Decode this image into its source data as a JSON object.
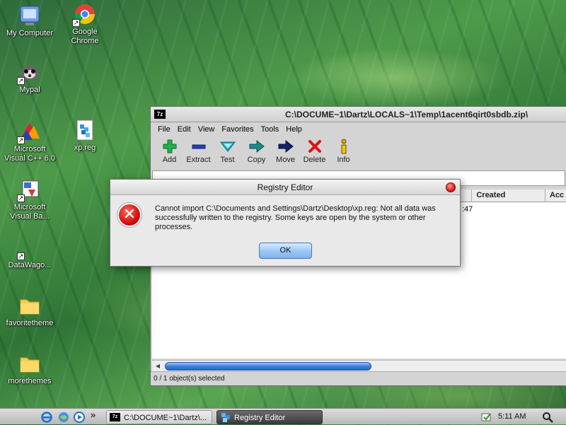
{
  "desktop": {
    "icons": [
      {
        "label": "My Computer",
        "icon": "computer-icon"
      },
      {
        "label": "Google\nChrome",
        "icon": "chrome-icon"
      },
      {
        "label": "Mypal",
        "icon": "mypal-icon"
      },
      {
        "label": "Microsoft\nVisual C++ 6.0",
        "icon": "visual-cpp-icon"
      },
      {
        "label": "xp.reg",
        "icon": "reg-file-icon"
      },
      {
        "label": "Microsoft\nVisual Ba...",
        "icon": "visual-basic-icon"
      },
      {
        "label": "DataWago...",
        "icon": "datawagon-icon"
      },
      {
        "label": "favoritetheme",
        "icon": "folder-icon"
      },
      {
        "label": "morethemes",
        "icon": "folder-icon"
      }
    ]
  },
  "archive_window": {
    "app_badge": "7z",
    "title": "C:\\DOCUME~1\\Dartz\\LOCALS~1\\Temp\\1acent6qirt0sbdb.zip\\",
    "menu": [
      "File",
      "Edit",
      "View",
      "Favorites",
      "Tools",
      "Help"
    ],
    "toolbar": [
      {
        "label": "Add",
        "icon": "plus-icon",
        "color": "#22b14c"
      },
      {
        "label": "Extract",
        "icon": "minus-icon",
        "color": "#1f3fbf"
      },
      {
        "label": "Test",
        "icon": "check-icon",
        "color": "#20a8c8"
      },
      {
        "label": "Copy",
        "icon": "copy-arrow-icon",
        "color": "#1a8a8a"
      },
      {
        "label": "Move",
        "icon": "move-arrow-icon",
        "color": "#13206e"
      },
      {
        "label": "Delete",
        "icon": "delete-x-icon",
        "color": "#e01010"
      },
      {
        "label": "Info",
        "icon": "info-icon",
        "color": "#d8a800"
      }
    ],
    "columns": [
      "Created",
      "Acc"
    ],
    "row_fragment": ":47",
    "status": "0 / 1 object(s) selected"
  },
  "dialog": {
    "title": "Registry Editor",
    "message": "Cannot import C:\\Documents and Settings\\Dartz\\Desktop\\xp.reg: Not all data was successfully written to the registry.  Some keys are open by the system or other processes.",
    "ok_label": "OK"
  },
  "taskbar": {
    "more_glyph": "»",
    "buttons": [
      {
        "label": "C:\\DOCUME~1\\Dartz\\...",
        "badge": "7z",
        "active": false
      },
      {
        "label": "Registry Editor",
        "active": true
      }
    ],
    "time": "5:11 AM"
  }
}
